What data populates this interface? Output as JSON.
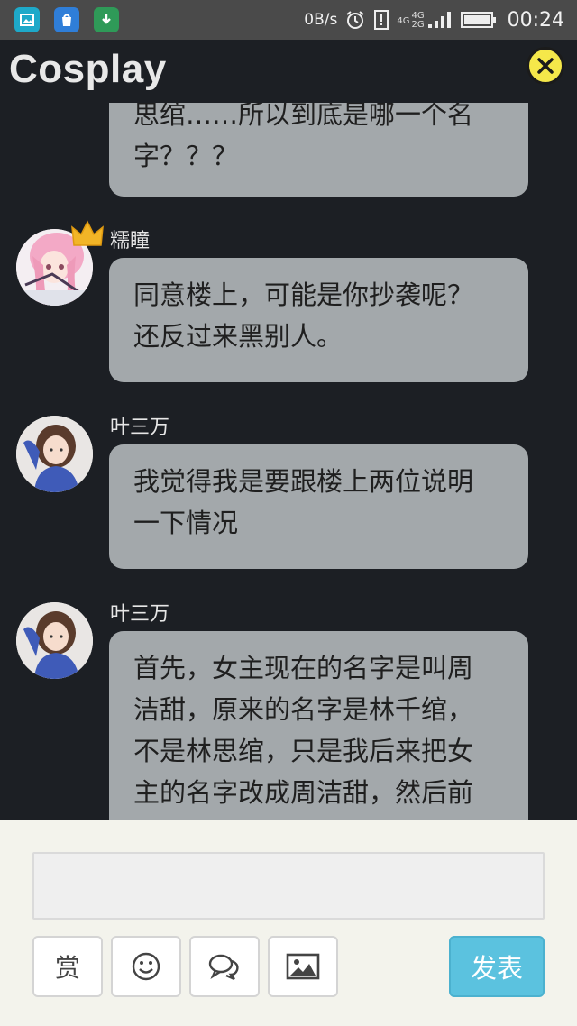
{
  "status_bar": {
    "net_speed": "0B/s",
    "network_labels": [
      "4G",
      "4G",
      "2G"
    ],
    "time": "00:24"
  },
  "header": {
    "title": "Cosplay"
  },
  "messages": [
    {
      "sender": "",
      "text": "思绾……所以到底是哪一个名\n字？？？"
    },
    {
      "sender": "糯瞳",
      "text": "同意楼上，可能是你抄袭呢？\n还反过来黑别人。"
    },
    {
      "sender": "叶三万",
      "text": "我觉得我是要跟楼上两位说明\n一下情况"
    },
    {
      "sender": "叶三万",
      "text": "首先，女主现在的名字是叫周\n洁甜，原来的名字是林千绾，\n不是林思绾，只是我后来把女\n主的名字改成周洁甜，然后前"
    }
  ],
  "input_panel": {
    "reward_label": "赏",
    "publish_label": "发表",
    "placeholder": ""
  },
  "colors": {
    "background": "#1c1f24",
    "bubble": "#a3a8ab",
    "publish": "#5bc2df",
    "close_button": "#f5e84a"
  }
}
